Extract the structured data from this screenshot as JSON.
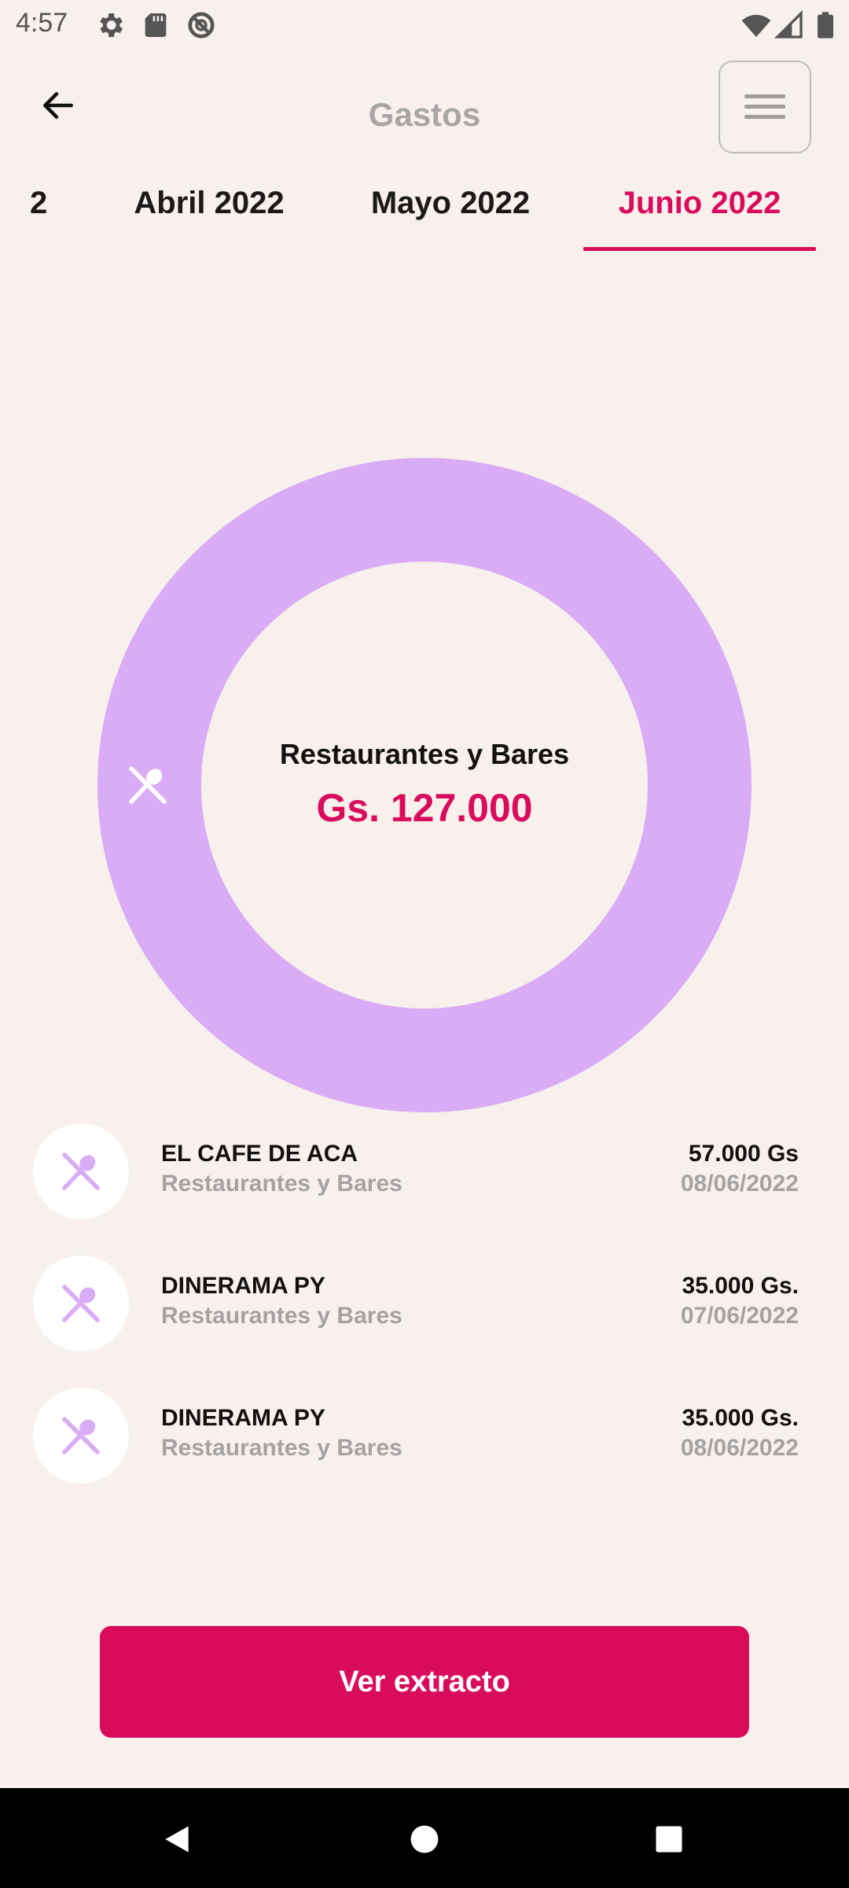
{
  "status_bar": {
    "time": "4:57",
    "icons": [
      "settings-icon",
      "sd-card-icon",
      "do-not-disturb-icon",
      "wifi-icon",
      "signal-icon",
      "battery-icon"
    ]
  },
  "header": {
    "title": "Gastos",
    "back_icon": "arrow-left-icon",
    "menu_icon": "hamburger-menu-icon"
  },
  "tabs": [
    {
      "label": "2",
      "active": false
    },
    {
      "label": "Abril 2022",
      "active": false
    },
    {
      "label": "Mayo 2022",
      "active": false
    },
    {
      "label": "Junio 2022",
      "active": true
    }
  ],
  "chart_data": {
    "type": "pie",
    "donut": true,
    "categories": [
      "Restaurantes y Bares"
    ],
    "values": [
      127000
    ],
    "colors": [
      "#d9acf5"
    ],
    "center_label": "Restaurantes y Bares",
    "center_value": "Gs. 127.000"
  },
  "transactions": [
    {
      "name": "EL CAFE DE ACA",
      "category": "Restaurantes y Bares",
      "amount": "57.000 Gs",
      "date": "08/06/2022",
      "icon": "utensils-icon"
    },
    {
      "name": "DINERAMA PY",
      "category": "Restaurantes y Bares",
      "amount": "35.000 Gs.",
      "date": "07/06/2022",
      "icon": "utensils-icon"
    },
    {
      "name": "DINERAMA PY",
      "category": "Restaurantes y Bares",
      "amount": "35.000 Gs.",
      "date": "08/06/2022",
      "icon": "utensils-icon"
    }
  ],
  "cta": {
    "label": "Ver extracto"
  },
  "colors": {
    "accent": "#d90b5c",
    "background": "#f7f0ec",
    "category": "#d9acf5",
    "muted_text": "#a3a3a3"
  }
}
